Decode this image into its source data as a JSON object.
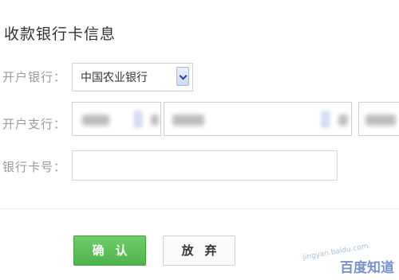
{
  "form": {
    "title": "收款银行卡信息",
    "bank_label": "开户银行：",
    "bank_selected": "中国农业银行",
    "branch_label": "开户支行：",
    "card_label": "银行卡号：",
    "card_value": ""
  },
  "actions": {
    "confirm_label": "确认",
    "cancel_label": "放弃"
  },
  "watermark": {
    "text": "百度知道",
    "url": "jingyan.baidu.com"
  }
}
